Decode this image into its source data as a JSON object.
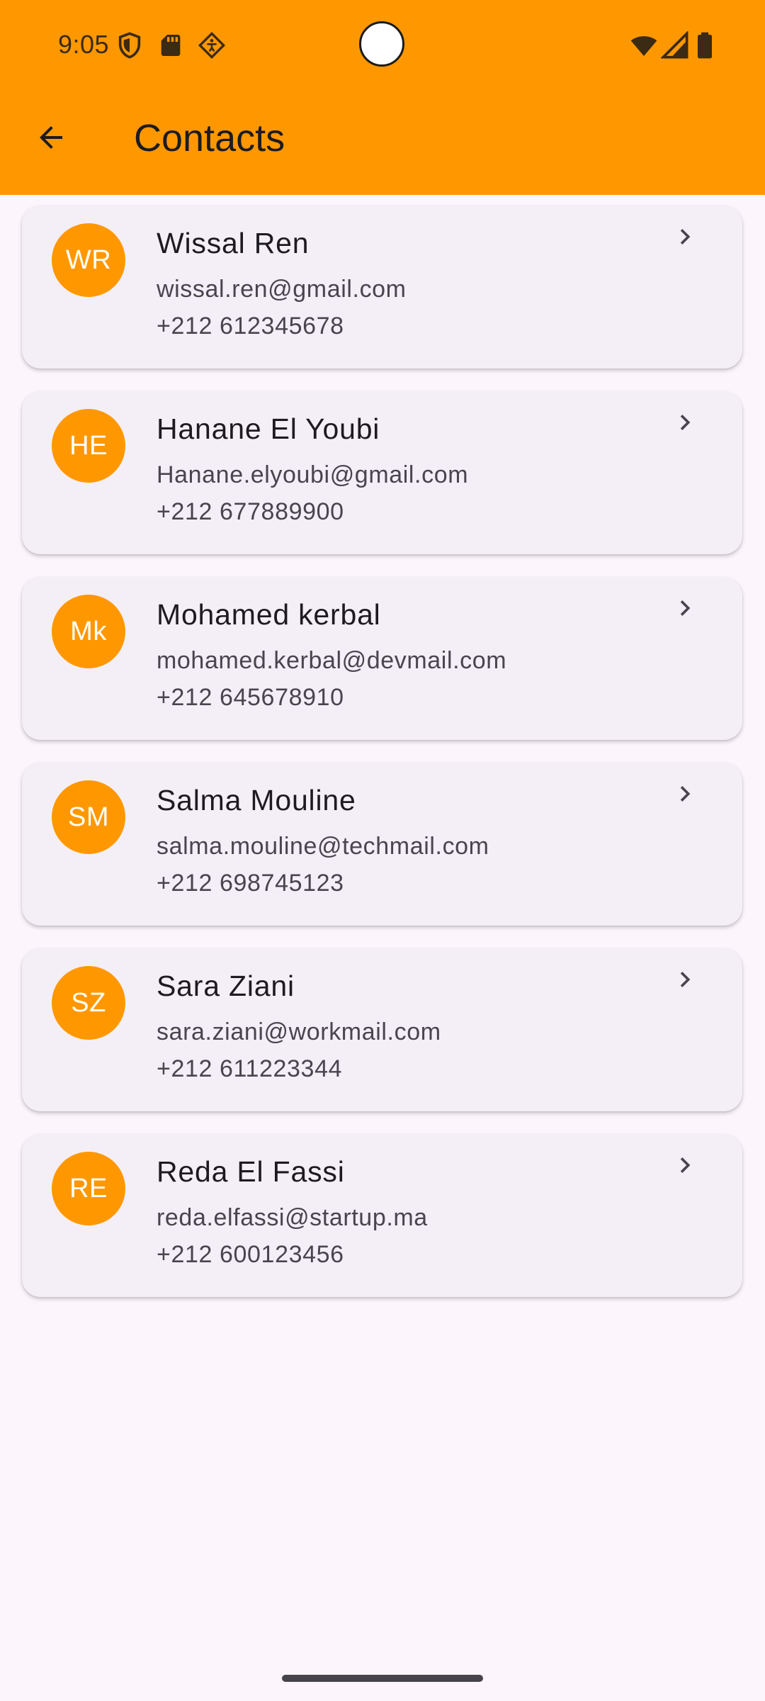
{
  "status_bar": {
    "time": "9:05",
    "left_icons": [
      "shield-icon",
      "sd-card-icon",
      "accessibility-icon"
    ],
    "right_icons": [
      "wifi-icon",
      "cell-signal-icon",
      "battery-icon"
    ]
  },
  "app_bar": {
    "title": "Contacts",
    "back_icon": "arrow-back-icon",
    "color": "#ff9800"
  },
  "contacts": [
    {
      "initials": "WR",
      "name": "Wissal Ren",
      "email": "wissal.ren@gmail.com",
      "phone": "+212 612345678"
    },
    {
      "initials": "HE",
      "name": "Hanane El Youbi",
      "email": "Hanane.elyoubi@gmail.com",
      "phone": "+212 677889900"
    },
    {
      "initials": "Mk",
      "name": "Mohamed kerbal",
      "email": "mohamed.kerbal@devmail.com",
      "phone": "+212 645678910"
    },
    {
      "initials": "SM",
      "name": "Salma Mouline",
      "email": "salma.mouline@techmail.com",
      "phone": "+212 698745123"
    },
    {
      "initials": "SZ",
      "name": "Sara Ziani",
      "email": "sara.ziani@workmail.com",
      "phone": "+212 611223344"
    },
    {
      "initials": "RE",
      "name": "Reda El Fassi",
      "email": "reda.elfassi@startup.ma",
      "phone": "+212 600123456"
    }
  ],
  "colors": {
    "accent": "#ff9800",
    "background": "#fcf6fc",
    "card": "#f4eff6"
  }
}
